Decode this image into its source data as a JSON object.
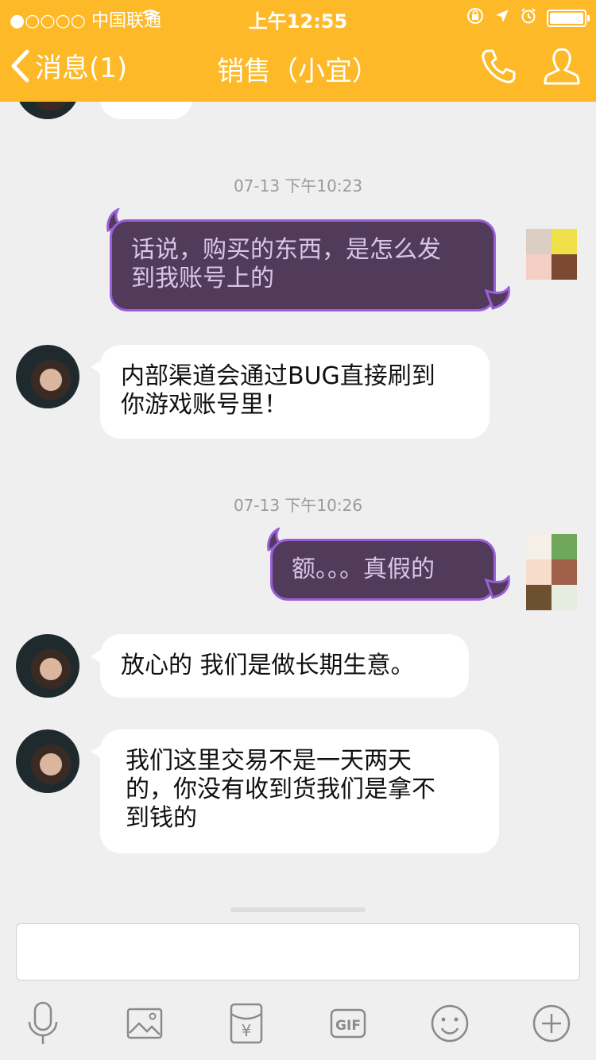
{
  "status": {
    "carrier": "●○○○○ 中国联通",
    "time": "上午12:55"
  },
  "nav": {
    "back_label": "消息(1)",
    "title": "销售（小宜）"
  },
  "colors": {
    "header": "#fdb927",
    "background": "#efeff0",
    "sent_bubble": "#523a5a",
    "sent_border": "#9a5fd8",
    "sent_text": "#d8c6ea",
    "received_bubble": "#ffffff"
  },
  "messages": {
    "ts1": "07-13 下午10:23",
    "m1_line1": "话说，购买的东西，是怎么发",
    "m1_line2": "到我账号上的",
    "m2_line1": "内部渠道会通过BUG直接刷到",
    "m2_line2": "你游戏账号里！",
    "ts2": "07-13 下午10:26",
    "m3": "额。。。真假的",
    "m4": "放心的 我们是做长期生意。",
    "m5_line1": "我们这里交易不是一天两天",
    "m5_line2": "的，你没有收到货我们是拿不",
    "m5_line3": "到钱的"
  },
  "toolbar": {
    "icons": [
      "microphone-icon",
      "image-icon",
      "red-packet-icon",
      "gif-icon",
      "emoji-icon",
      "plus-icon"
    ],
    "gif_label": "GIF",
    "currency_symbol": "¥"
  }
}
